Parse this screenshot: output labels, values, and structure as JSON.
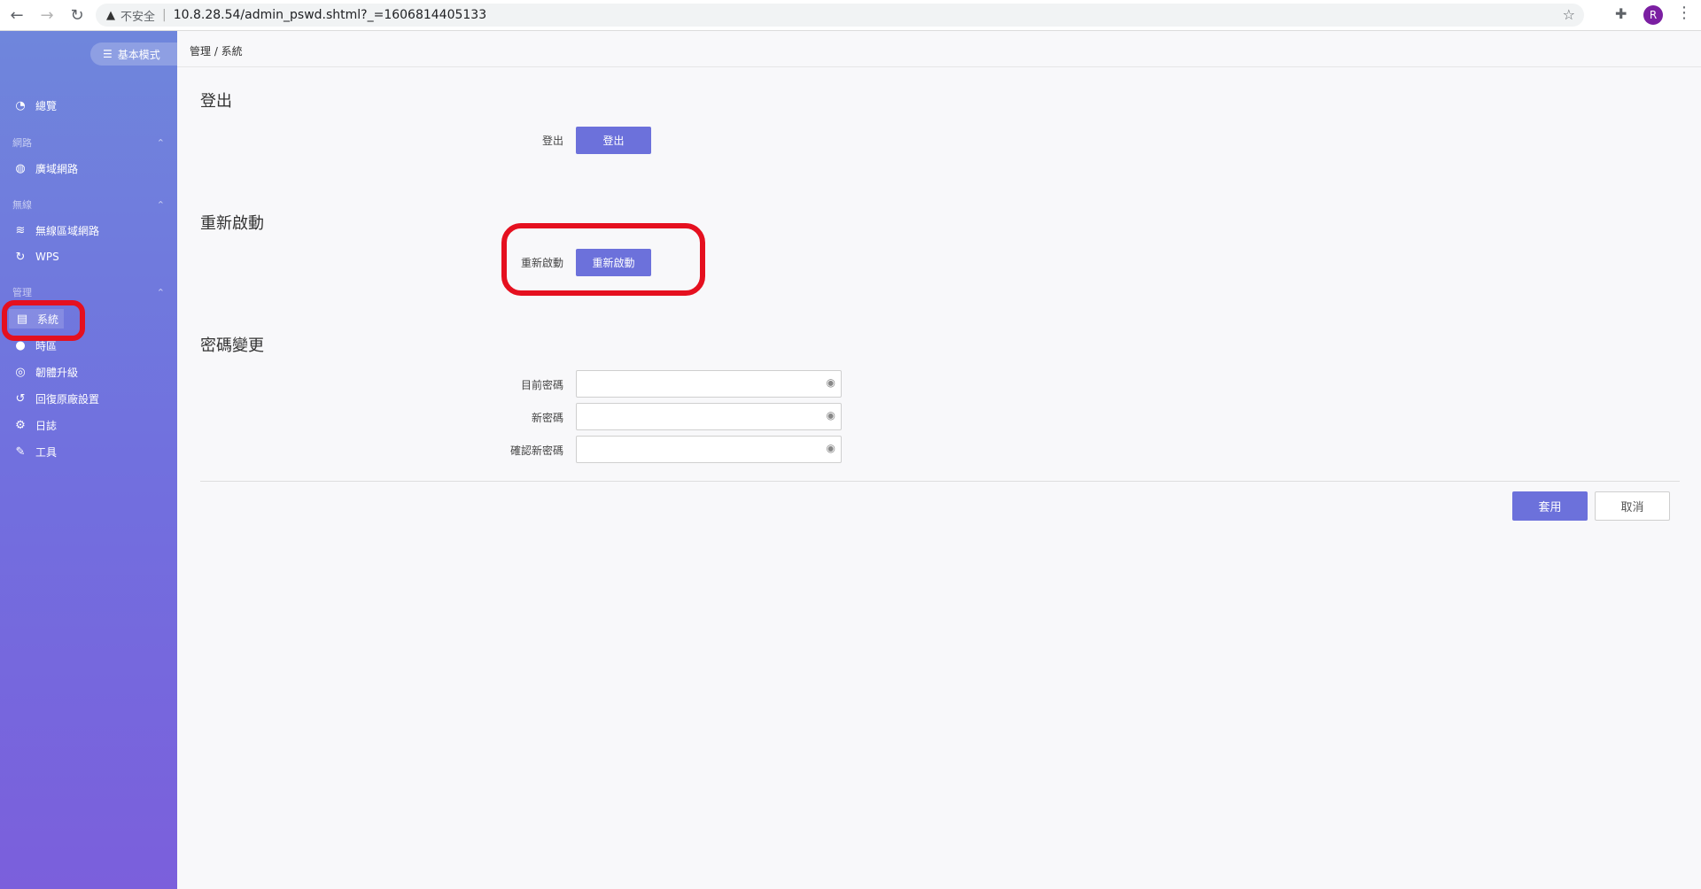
{
  "browser": {
    "back": "←",
    "forward": "→",
    "reload": "↻",
    "warning_icon": "▲",
    "insecure_label": "不安全",
    "url": "10.8.28.54/admin_pswd.shtml?_=1606814405133",
    "star": "☆",
    "extensions": "✚",
    "profile_initial": "R",
    "menu": "⋮"
  },
  "sidebar": {
    "mode_button": "基本模式",
    "overview": "總覽",
    "sections": {
      "network": "網路",
      "wireless": "無線",
      "management": "管理"
    },
    "items": {
      "wan": "廣域網路",
      "wlan": "無線區域網路",
      "wps": "WPS",
      "system": "系統",
      "timezone": "時區",
      "firmware": "韌體升級",
      "reset": "回復原廠設置",
      "log": "日誌",
      "tools": "工具"
    }
  },
  "main": {
    "breadcrumb": "管理 / 系統",
    "logout": {
      "title": "登出",
      "label": "登出",
      "button": "登出"
    },
    "restart": {
      "title": "重新啟動",
      "label": "重新啟動",
      "button": "重新啟動"
    },
    "password": {
      "title": "密碼變更",
      "current_label": "目前密碼",
      "new_label": "新密碼",
      "confirm_label": "確認新密碼"
    },
    "apply": "套用",
    "cancel": "取消"
  }
}
